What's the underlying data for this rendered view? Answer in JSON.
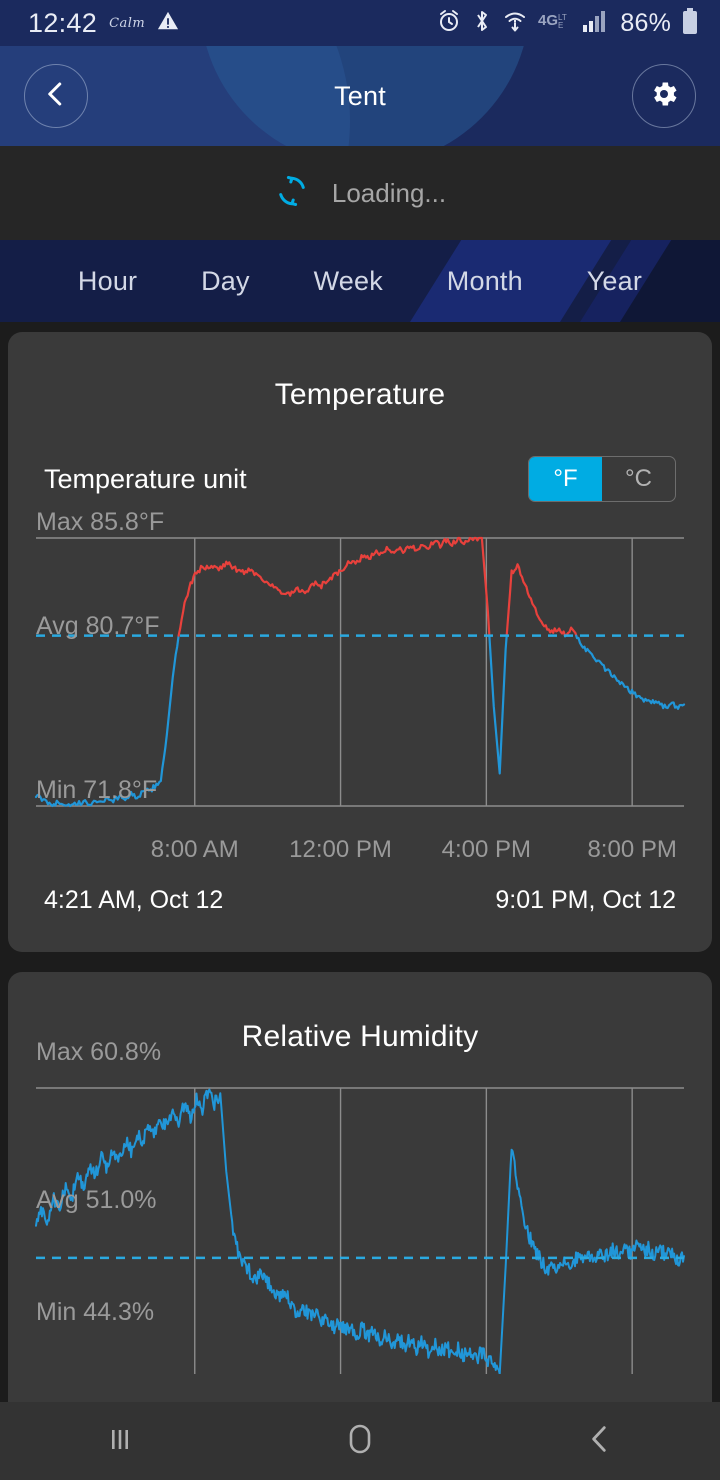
{
  "statusbar": {
    "time": "12:42",
    "app_badge": "Calm",
    "battery": "86%",
    "icons": [
      "warning-icon",
      "alarm-icon",
      "bluetooth-icon",
      "wifi-icon",
      "4glte-icon",
      "signal-icon",
      "battery-icon"
    ]
  },
  "header": {
    "title": "Tent",
    "back_icon": "chevron-left-icon",
    "settings_icon": "gear-icon"
  },
  "loading": {
    "text": "Loading...",
    "icon": "refresh-spinner-icon"
  },
  "tabs": [
    {
      "label": "Hour"
    },
    {
      "label": "Day"
    },
    {
      "label": "Week"
    },
    {
      "label": "Month"
    },
    {
      "label": "Year"
    }
  ],
  "temperature_card": {
    "title": "Temperature",
    "unit_label": "Temperature unit",
    "unit_options": [
      {
        "label": "°F",
        "selected": true
      },
      {
        "label": "°C",
        "selected": false
      }
    ],
    "max_label": "Max 85.8°F",
    "avg_label": "Avg 80.7°F",
    "min_label": "Min 71.8°F",
    "range_start": "4:21 AM,  Oct 12",
    "range_end": "9:01 PM,  Oct 12"
  },
  "humidity_card": {
    "title": "Relative Humidity",
    "max_label": "Max 60.8%",
    "avg_label": "Avg 51.0%",
    "min_label": "Min 44.3%"
  },
  "navbar": {
    "recents_icon": "recents-icon",
    "home_icon": "home-icon",
    "back_icon": "back-chevron-icon"
  },
  "colors": {
    "header_blue": "#1b2a5e",
    "tabbar_blue": "#141e47",
    "card_bg": "#3a3a3a",
    "accent_cyan": "#00ACE3",
    "series_hot": "#e8413c",
    "series_cool": "#2196d8",
    "gridline": "#8c8c8c"
  },
  "chart_data": [
    {
      "type": "line",
      "title": "Temperature",
      "xlabel": "",
      "ylabel": "°F",
      "ylim": [
        71.8,
        85.8
      ],
      "xlim": [
        "4:21 AM, Oct 12",
        "9:01 PM, Oct 12"
      ],
      "grid": true,
      "legend": "none",
      "stats": {
        "max": 85.8,
        "avg": 80.7,
        "min": 71.8,
        "unit": "°F"
      },
      "xticks": [
        "8:00 AM",
        "12:00 PM",
        "4:00 PM",
        "8:00 PM"
      ],
      "xtick_positions": [
        0.245,
        0.47,
        0.695,
        0.92
      ],
      "avg_reference_line": 80.7,
      "series": [
        {
          "name": "Temperature",
          "color_above_avg": "#e8413c",
          "color_below_avg": "#2196d8",
          "values": [
            72.4,
            72.1,
            72.0,
            71.9,
            72.0,
            71.9,
            71.8,
            71.9,
            72.0,
            71.9,
            72.1,
            72.0,
            72.2,
            72.1,
            72.3,
            72.2,
            72.4,
            72.3,
            72.5,
            72.6,
            72.8,
            73.2,
            75.5,
            78.5,
            80.7,
            82.3,
            83.4,
            84.0,
            84.3,
            84.2,
            84.4,
            84.2,
            84.5,
            84.3,
            84.1,
            84.0,
            84.2,
            83.9,
            83.7,
            83.5,
            83.2,
            83.0,
            82.8,
            82.9,
            83.1,
            82.9,
            83.2,
            83.4,
            83.3,
            83.6,
            83.8,
            84.0,
            84.3,
            84.6,
            84.5,
            84.9,
            84.7,
            85.1,
            84.9,
            85.2,
            85.0,
            85.3,
            85.1,
            85.4,
            85.2,
            85.5,
            85.3,
            85.6,
            85.4,
            85.7,
            85.5,
            85.8,
            85.6,
            85.8,
            85.7,
            85.8,
            82.0,
            77.0,
            73.5,
            80.0,
            84.0,
            84.3,
            83.6,
            82.8,
            82.0,
            81.4,
            81.0,
            80.9,
            81.1,
            80.8,
            81.0,
            80.6,
            80.2,
            79.8,
            79.5,
            79.2,
            78.9,
            78.6,
            78.3,
            78.0,
            77.8,
            77.6,
            77.4,
            77.3,
            77.2,
            77.1,
            77.0,
            77.1,
            77.0,
            77.1
          ]
        }
      ]
    },
    {
      "type": "line",
      "title": "Relative Humidity",
      "xlabel": "",
      "ylabel": "%",
      "ylim": [
        44.3,
        60.8
      ],
      "grid": true,
      "legend": "none",
      "stats": {
        "max": 60.8,
        "avg": 51.0,
        "min": 44.3,
        "unit": "%"
      },
      "avg_reference_line": 51.0,
      "series": [
        {
          "name": "Relative Humidity",
          "color": "#2196d8",
          "values": [
            53.0,
            53.8,
            53.2,
            54.4,
            54.0,
            55.0,
            54.5,
            55.6,
            55.1,
            56.2,
            55.7,
            56.8,
            56.2,
            57.2,
            56.7,
            57.8,
            57.2,
            58.2,
            57.7,
            58.6,
            58.1,
            59.0,
            58.5,
            59.4,
            58.9,
            59.8,
            59.2,
            60.2,
            59.6,
            60.8,
            59.9,
            60.5,
            56.0,
            53.0,
            51.2,
            50.6,
            50.2,
            49.8,
            50.2,
            49.6,
            49.2,
            48.6,
            48.9,
            48.2,
            47.8,
            48.2,
            47.6,
            47.9,
            47.2,
            47.6,
            47.0,
            47.3,
            46.8,
            47.1,
            46.6,
            46.9,
            46.4,
            46.8,
            46.2,
            46.6,
            46.0,
            46.4,
            45.9,
            46.3,
            45.8,
            46.2,
            45.6,
            46.0,
            45.5,
            45.9,
            45.4,
            45.8,
            45.3,
            45.7,
            45.2,
            45.6,
            45.0,
            44.8,
            44.3,
            50.5,
            57.5,
            55.0,
            53.4,
            52.2,
            51.4,
            50.8,
            50.4,
            50.7,
            50.3,
            50.8,
            50.5,
            51.0,
            50.7,
            51.2,
            50.9,
            51.4,
            51.1,
            51.5,
            51.2,
            51.6,
            51.3,
            51.7,
            51.4,
            51.6,
            51.2,
            51.5,
            51.1,
            51.3,
            50.9,
            51.1
          ]
        }
      ]
    }
  ]
}
